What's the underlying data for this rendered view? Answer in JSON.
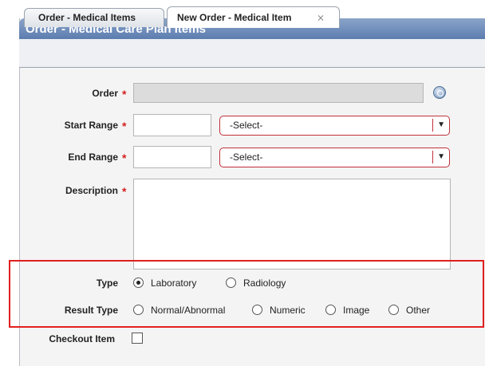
{
  "window": {
    "title": "Order - Medical Care Plan Items"
  },
  "tabs": [
    {
      "label": "Order - Medical Items"
    },
    {
      "label": "New Order - Medical Item",
      "close": "⨯"
    }
  ],
  "form": {
    "order": {
      "label": "Order",
      "value": ""
    },
    "start_range": {
      "label": "Start Range",
      "value": "",
      "unit": "-Select-"
    },
    "end_range": {
      "label": "End Range",
      "value": "",
      "unit": "-Select-"
    },
    "description": {
      "label": "Description",
      "value": ""
    },
    "required_marker": "*",
    "type": {
      "label": "Type",
      "options": [
        "Laboratory",
        "Radiology"
      ],
      "selected": "Laboratory"
    },
    "result_type": {
      "label": "Result Type",
      "options": [
        "Normal/Abnormal",
        "Numeric",
        "Image",
        "Other"
      ],
      "selected": ""
    },
    "checkout_item": {
      "label": "Checkout Item",
      "checked": false
    }
  },
  "colors": {
    "title_bar": "#5d7db0",
    "required": "#d42020",
    "highlight": "#e02020"
  }
}
